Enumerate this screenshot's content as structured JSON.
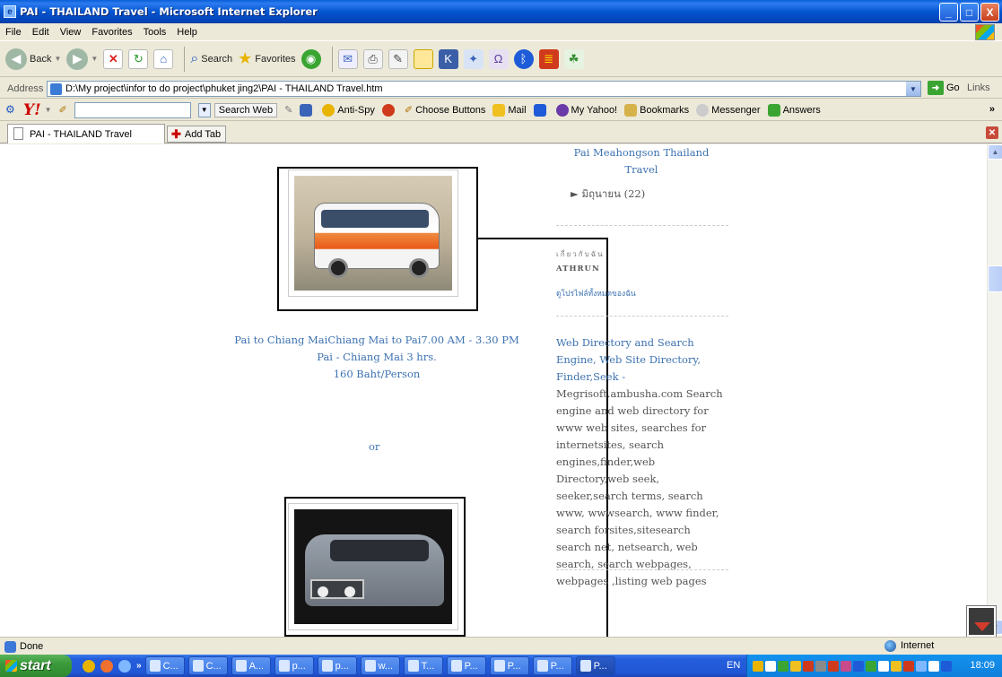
{
  "window": {
    "title": "PAI - THAILAND Travel - Microsoft Internet Explorer",
    "buttons": [
      "_",
      "□",
      "X"
    ]
  },
  "menu": [
    "File",
    "Edit",
    "View",
    "Favorites",
    "Tools",
    "Help"
  ],
  "toolbar": {
    "back_label": "Back",
    "search_label": "Search",
    "favorites_label": "Favorites"
  },
  "address": {
    "label": "Address",
    "value": "D:\\My project\\infor to do project\\phuket jing2\\PAI - THAILAND Travel.htm",
    "go_label": "Go",
    "links_label": "Links"
  },
  "yahoo_toolbar": {
    "logo": "Y!",
    "search_web_label": "Search Web",
    "anti_spy_label": "Anti-Spy",
    "choose_buttons_label": "Choose Buttons",
    "mail_label": "Mail",
    "my_yahoo_label": "My Yahoo!",
    "bookmarks_label": "Bookmarks",
    "messenger_label": "Messenger",
    "answers_label": "Answers"
  },
  "tabs": {
    "active_tab": "PAI - THAILAND Travel",
    "add_tab_label": "Add Tab"
  },
  "page": {
    "sidebar_link_title": "Pai Meahongson Thailand Travel",
    "archive_month": "► มิถุนายน (22)",
    "about_heading": "เกี่ยวกับฉัน",
    "author_name": "ATHRUN",
    "profile_link": "ดูโปรไฟล์ทั้งหมดของฉัน",
    "webdir_title": "Web Directory and Search Engine, Web Site Directory, Finder,Seek -",
    "webdir_body": "Megrisoft.ambusha.com Search engine and web directory for www web sites, searches for internetsites, search engines,finder,web Directory,web seek, seeker,search terms, search www, wwwsearch, www finder, search forsites,sitesearch search net, netsearch, web search, search webpages, webpages ,listing web pages",
    "caption_line1": "Pai to Chiang MaiChiang Mai to Pai7.00 AM - 3.30 PM",
    "caption_line2": "Pai - Chiang Mai 3 hrs.",
    "caption_line3": "160 Baht/Person",
    "or_text": "or"
  },
  "status": {
    "left": "Done",
    "zone": "Internet"
  },
  "taskbar": {
    "start_label": "start",
    "tasks": [
      "C...",
      "C...",
      "A...",
      "p...",
      "p...",
      "w...",
      "T...",
      "P...",
      "P...",
      "P...",
      "P..."
    ],
    "lang": "EN",
    "clock": "18:09"
  }
}
